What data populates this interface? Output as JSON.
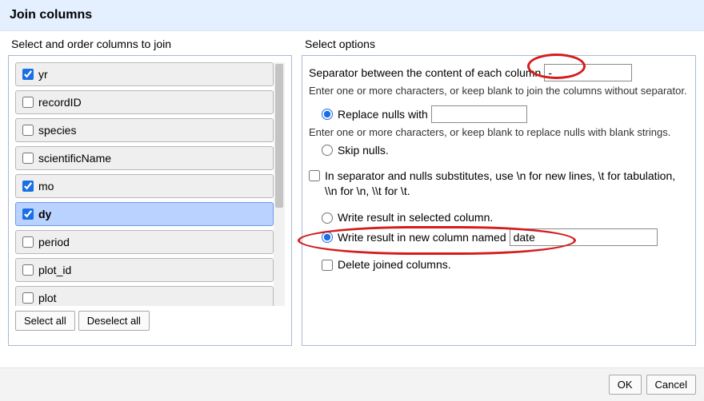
{
  "header": {
    "title": "Join columns"
  },
  "left": {
    "title": "Select and order columns to join",
    "columns": [
      {
        "name": "yr",
        "checked": true,
        "highlight": false
      },
      {
        "name": "recordID",
        "checked": false,
        "highlight": false
      },
      {
        "name": "species",
        "checked": false,
        "highlight": false
      },
      {
        "name": "scientificName",
        "checked": false,
        "highlight": false
      },
      {
        "name": "mo",
        "checked": true,
        "highlight": false
      },
      {
        "name": "dy",
        "checked": true,
        "highlight": true
      },
      {
        "name": "period",
        "checked": false,
        "highlight": false
      },
      {
        "name": "plot_id",
        "checked": false,
        "highlight": false
      },
      {
        "name": "plot",
        "checked": false,
        "highlight": false
      }
    ],
    "buttons": {
      "select_all": "Select all",
      "deselect_all": "Deselect all"
    }
  },
  "right": {
    "title": "Select options",
    "separator_label": "Separator between the content of each column",
    "separator_value": "-",
    "separator_hint": "Enter one or more characters, or keep blank to join the columns without separator.",
    "nulls": {
      "replace_label": "Replace nulls with",
      "replace_value": "",
      "replace_hint": "Enter one or more characters, or keep blank to replace nulls with blank strings.",
      "skip_label": "Skip nulls.",
      "selected": "replace"
    },
    "escape_label": "In separator and nulls substitutes, use \\n for new lines, \\t for tabulation, \\\\n for \\n, \\\\t for \\t.",
    "escape_checked": false,
    "write": {
      "selected_col_label": "Write result in selected column.",
      "new_col_label": "Write result in new column named",
      "new_col_value": "date",
      "selected": "new"
    },
    "delete_label": "Delete joined columns.",
    "delete_checked": false
  },
  "footer": {
    "ok": "OK",
    "cancel": "Cancel"
  }
}
